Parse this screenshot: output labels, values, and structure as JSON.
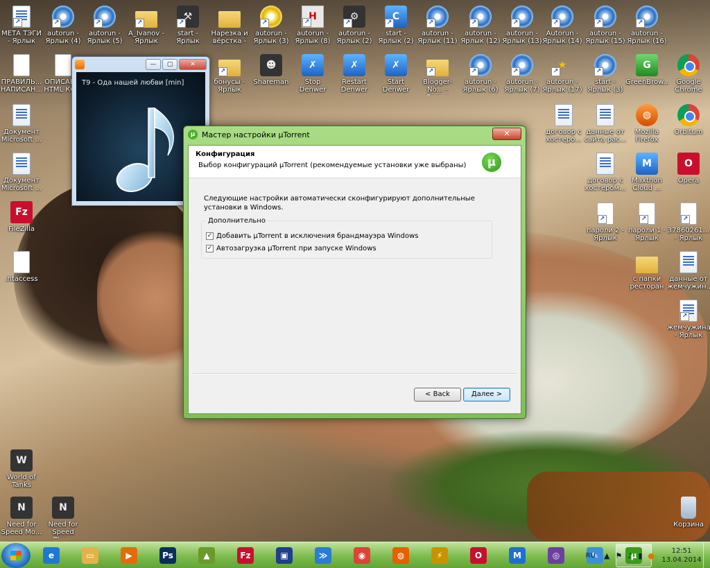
{
  "desktop": {
    "icons": [
      {
        "label": "МЕТА ТЭГИ - Ярлык",
        "icon": "word-document-icon"
      },
      {
        "label": "autorun - Ярлык (4)",
        "icon": "autorun-disc-icon"
      },
      {
        "label": "autorun - Ярлык (5)",
        "icon": "autorun-disc-icon"
      },
      {
        "label": "A_Ivanov - Ярлык",
        "icon": "folder-icon"
      },
      {
        "label": "start - Ярлык",
        "icon": "tools-icon"
      },
      {
        "label": "Нарезка и вёрстка -",
        "icon": "folder-icon"
      },
      {
        "label": "autorun - Ярлык (3)",
        "icon": "compass-icon"
      },
      {
        "label": "autorun - Ярлык (8)",
        "icon": "h-app-icon"
      },
      {
        "label": "autorun - Ярлык (2)",
        "icon": "gear-icon"
      },
      {
        "label": "start - Ярлык (2)",
        "icon": "c-app-icon"
      },
      {
        "label": "autorun - Ярлык (11)",
        "icon": "autorun-disc-icon"
      },
      {
        "label": "autorun - Ярлык (12)",
        "icon": "autorun-disc-icon"
      },
      {
        "label": "autorun - Ярлык (13)",
        "icon": "autorun-disc-icon"
      },
      {
        "label": "Autorun - Ярлык (14)",
        "icon": "autorun-disc-icon"
      },
      {
        "label": "autorun - Ярлык (15)",
        "icon": "autorun-disc-icon"
      },
      {
        "label": "autorun - Ярлык (16)",
        "icon": "autorun-disc-icon"
      },
      {
        "label": "ПРАВИЛЬ... НАПИСАН...",
        "icon": "text-file-icon"
      },
      {
        "label": "ОПИСАН... HTML КО...",
        "icon": "text-file-icon"
      },
      {
        "label": "бонусы - Ярлык",
        "icon": "folder-icon"
      },
      {
        "label": "Shareman",
        "icon": "shareman-icon"
      },
      {
        "label": "Stop Denwer",
        "icon": "denwer-icon"
      },
      {
        "label": "Restart Denwer",
        "icon": "denwer-icon"
      },
      {
        "label": "Start Denwer",
        "icon": "denwer-icon"
      },
      {
        "label": "Blogger-No... - Ярлык",
        "icon": "folder-icon"
      },
      {
        "label": "autorun - Ярлык (6)",
        "icon": "autorun-disc-icon"
      },
      {
        "label": "autorun - Ярлык (7)",
        "icon": "autorun-disc-icon"
      },
      {
        "label": "autorun - Ярлык (17)",
        "icon": "star-icon"
      },
      {
        "label": "start - Ярлык (3)",
        "icon": "autorun-disc-icon"
      },
      {
        "label": "GreenBrow...",
        "icon": "greenbrowser-icon"
      },
      {
        "label": "Google Chrome",
        "icon": "chrome-icon"
      },
      {
        "label": "Документ Microsoft ...",
        "icon": "word-document-icon"
      },
      {
        "label": "договор с хостеро...",
        "icon": "word-document-icon"
      },
      {
        "label": "данные от сайта рас...",
        "icon": "word-document-icon"
      },
      {
        "label": "Mozilla Firefox",
        "icon": "firefox-icon"
      },
      {
        "label": "Orbitum",
        "icon": "orbitum-icon"
      },
      {
        "label": "Документ Microsoft ...",
        "icon": "word-document-icon"
      },
      {
        "label": "договор с хостером...",
        "icon": "word-document-icon"
      },
      {
        "label": "Maxthon Cloud ...",
        "icon": "maxthon-icon"
      },
      {
        "label": "Opera",
        "icon": "opera-icon"
      },
      {
        "label": "FileZilla",
        "icon": "filezilla-icon"
      },
      {
        "label": "пароли 2 - Ярлык",
        "icon": "text-file-icon"
      },
      {
        "label": "пароли 1 - Ярлык",
        "icon": "text-file-icon"
      },
      {
        "label": "37860261... - Ярлык",
        "icon": "text-file-icon"
      },
      {
        "label": ".htaccess",
        "icon": "blank-file-icon"
      },
      {
        "label": "с папки ресторан с...",
        "icon": "folder-icon"
      },
      {
        "label": "данные от жемчужин...",
        "icon": "word-document-icon"
      },
      {
        "label": "жемчужина - Ярлык",
        "icon": "word-document-icon"
      },
      {
        "label": "World of Tanks",
        "icon": "world-of-tanks-icon"
      },
      {
        "label": "Need for Speed Mo...",
        "icon": "nfs-icon"
      },
      {
        "label": "Need for Speed The...",
        "icon": "nfs-icon"
      },
      {
        "label": "Корзина",
        "icon": "recycle-bin-icon"
      }
    ]
  },
  "player": {
    "title_icon": "media-player-icon",
    "track": "T9 - Ода нашей любви [min]",
    "artwork": "music-note-icon"
  },
  "dialog": {
    "title": "Мастер настройки µTorrent",
    "close": "✕",
    "header_title": "Конфигурация",
    "header_subtitle": "Выбор конфигураций µTorrent (рекомендуемые установки уже выбраны)",
    "logo": "µ",
    "description": "Следующие настройки автоматически сконфигурируют дополнительные установки в Windows.",
    "group_label": "Дополнительно",
    "options": [
      {
        "label": "Добавить µTorrent в исключения брандмауэра Windows",
        "checked": true
      },
      {
        "label": "Автозагрузка µTorrent при запуске Windows",
        "checked": true
      }
    ],
    "back_label": "< Back",
    "next_label": "Далее >"
  },
  "taskbar": {
    "items": [
      {
        "icon": "ie-icon",
        "glyph": "e",
        "color": "#1e78d6"
      },
      {
        "icon": "explorer-folder-icon",
        "glyph": "▭",
        "color": "#e3b34a"
      },
      {
        "icon": "media-player-icon",
        "glyph": "▶",
        "color": "#e36c0a"
      },
      {
        "icon": "photoshop-icon",
        "glyph": "Ps",
        "color": "#0a2e5c"
      },
      {
        "icon": "chart-app-icon",
        "glyph": "▲",
        "color": "#6a9a2a"
      },
      {
        "icon": "filezilla-icon",
        "glyph": "Fz",
        "color": "#c8102e"
      },
      {
        "icon": "save-disk-icon",
        "glyph": "▣",
        "color": "#203e8f"
      },
      {
        "icon": "fast-app-icon",
        "glyph": "≫",
        "color": "#2a7cd4"
      },
      {
        "icon": "chrome-icon",
        "glyph": "◉",
        "color": "#db4437"
      },
      {
        "icon": "firefox-icon",
        "glyph": "◍",
        "color": "#e66000"
      },
      {
        "icon": "winamp-icon",
        "glyph": "⚡",
        "color": "#c79400"
      },
      {
        "icon": "opera-icon",
        "glyph": "O",
        "color": "#c8102e"
      },
      {
        "icon": "maxthon-icon",
        "glyph": "M",
        "color": "#1e6fd0"
      },
      {
        "icon": "orbitum-icon",
        "glyph": "◎",
        "color": "#6d3fa0"
      },
      {
        "icon": "paint-icon",
        "glyph": "✎",
        "color": "#3c8fd8"
      },
      {
        "icon": "utorrent-icon",
        "glyph": "µ",
        "color": "#3c9b1c"
      }
    ],
    "active_index": 15,
    "language": "RU",
    "clock_time": "12:51",
    "clock_date": "13.04.2014"
  }
}
